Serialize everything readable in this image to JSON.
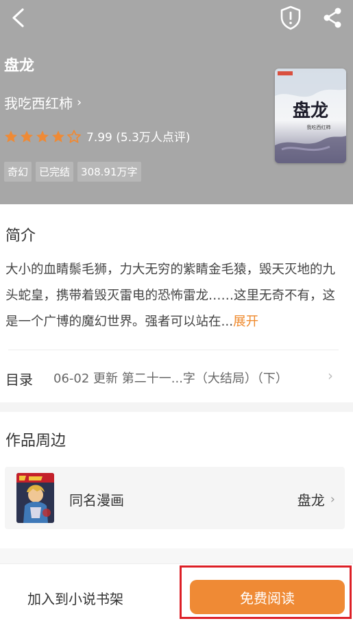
{
  "book": {
    "title": "盘龙",
    "author": "我吃西红柿",
    "rating": 7.99,
    "rating_label": "7.99",
    "rating_count": "(5.3万人点评)",
    "stars_filled": 4,
    "stars_total": 5,
    "tags": [
      "奇幻",
      "已完结",
      "308.91万字"
    ],
    "cover_title": "盘龙",
    "cover_author": "我吃西红柿"
  },
  "intro": {
    "heading": "简介",
    "text": "大小的血睛鬃毛狮，力大无穷的紫睛金毛猿，毁天灭地的九头蛇皇，携带着毁灭雷电的恐怖雷龙……这里无奇不有，这是一个广博的魔幻世界。强者可以站在...",
    "expand_label": "展开"
  },
  "toc": {
    "label": "目录",
    "latest": "06-02  更新  第二十一...字（大结局）（下）"
  },
  "works": {
    "heading": "作品周边",
    "item_label": "同名漫画",
    "item_value": "盘龙"
  },
  "bottom": {
    "shelf_label": "加入到小说书架",
    "read_label": "免费阅读"
  },
  "colors": {
    "header_bg": "#a7a7a7",
    "accent": "#ef8a35",
    "highlight": "#dd1f26"
  },
  "icons": {
    "back": "back-arrow-icon",
    "shield": "shield-alert-icon",
    "share": "share-icon",
    "star": "star-icon"
  }
}
